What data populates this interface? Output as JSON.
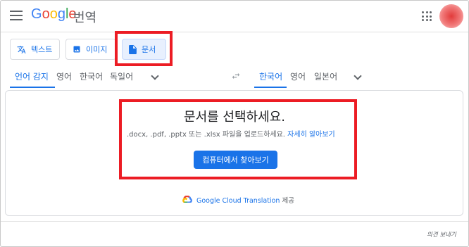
{
  "header": {
    "logo_letters": [
      "G",
      "o",
      "o",
      "g",
      "l",
      "e"
    ],
    "product": "번역"
  },
  "modes": [
    {
      "label": "텍스트",
      "icon": "translate-icon"
    },
    {
      "label": "이미지",
      "icon": "image-icon"
    },
    {
      "label": "문서",
      "icon": "document-icon"
    }
  ],
  "source_languages": [
    "언어 감지",
    "영어",
    "한국어",
    "독일어"
  ],
  "target_languages": [
    "한국어",
    "영어",
    "일본어"
  ],
  "document": {
    "title": "문서를 선택하세요.",
    "formats": ".docx, .pdf, .pptx 또는 .xlsx 파일을 업로드하세요.",
    "learn_more": "자세히 알아보기",
    "browse_button": "컴퓨터에서 찾아보기"
  },
  "attribution": {
    "service": "Google Cloud Translation",
    "suffix": "제공"
  },
  "footer": {
    "feedback": "의견 보내기"
  },
  "colors": {
    "accent": "#1a73e8",
    "highlight_box": "#ec1c24",
    "active_tab_bg": "#e8f0fe"
  }
}
